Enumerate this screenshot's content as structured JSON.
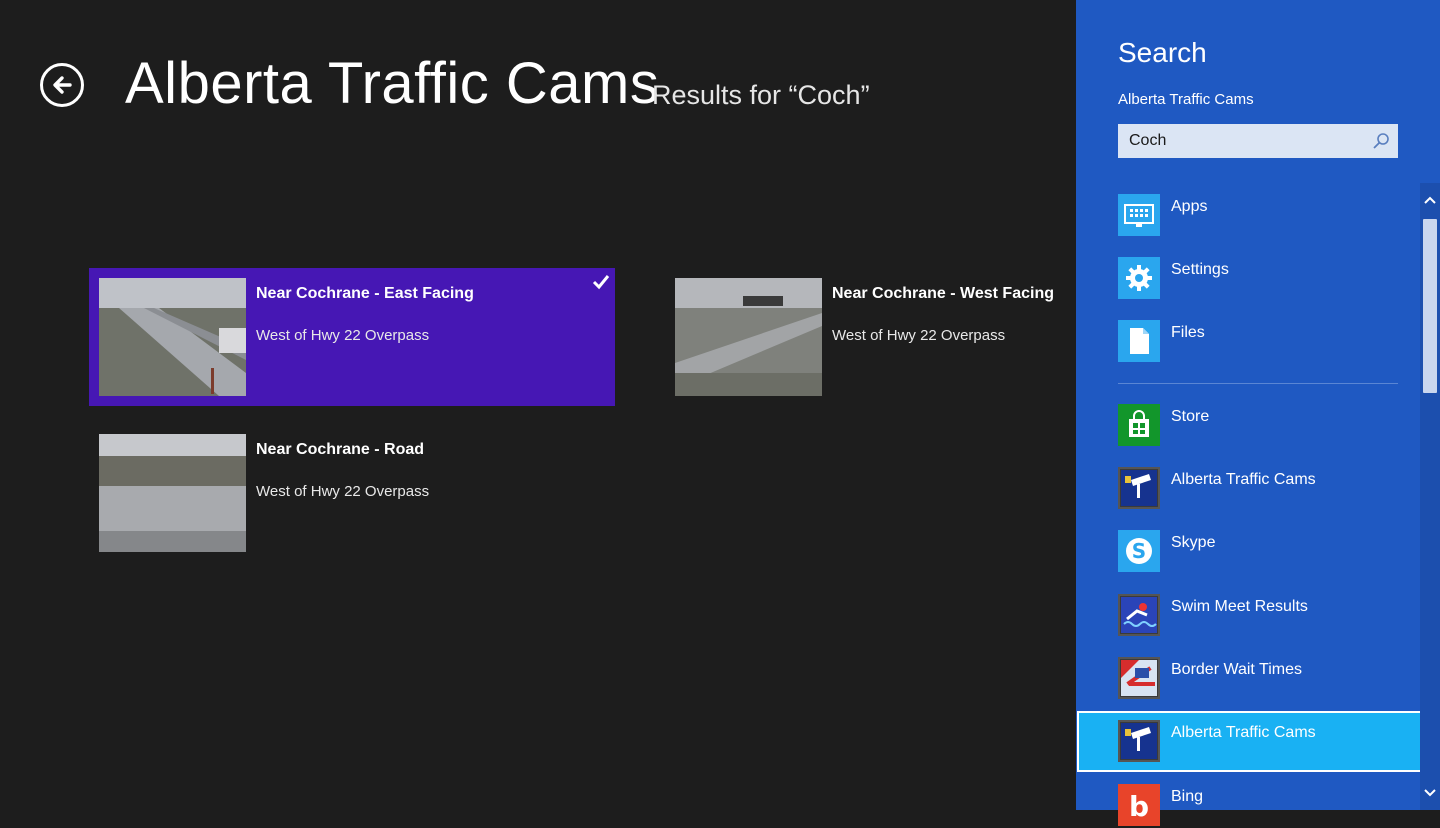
{
  "header": {
    "app_title": "Alberta Traffic Cams",
    "results_for": "Results for “Coch”"
  },
  "results": [
    {
      "title": "Near Cochrane - East Facing",
      "subtitle": "West of Hwy 22 Overpass",
      "selected": true
    },
    {
      "title": "Near Cochrane - West Facing",
      "subtitle": "West of Hwy 22 Overpass",
      "selected": false
    },
    {
      "title": "Near Cochrane - Road",
      "subtitle": "West of Hwy 22 Overpass",
      "selected": false
    }
  ],
  "search_pane": {
    "title": "Search",
    "scope": "Alberta Traffic Cams",
    "query": "Coch",
    "items": [
      {
        "label": "Apps",
        "icon": "apps-icon"
      },
      {
        "label": "Settings",
        "icon": "gear-icon"
      },
      {
        "label": "Files",
        "icon": "file-icon"
      },
      {
        "label": "Store",
        "icon": "store-icon"
      },
      {
        "label": "Alberta Traffic Cams",
        "icon": "traffic-camera-icon"
      },
      {
        "label": "Skype",
        "icon": "skype-icon"
      },
      {
        "label": "Swim Meet Results",
        "icon": "swimmer-icon"
      },
      {
        "label": "Border Wait Times",
        "icon": "flag-icon"
      },
      {
        "label": "Alberta Traffic Cams",
        "icon": "traffic-camera-icon",
        "highlighted": true
      },
      {
        "label": "Bing",
        "icon": "bing-icon"
      }
    ]
  },
  "colors": {
    "background": "#1d1d1d",
    "selected_tile": "#4617b4",
    "pane": "#1f59c2",
    "highlight": "#19b1f3",
    "tile_icon": "#2aa6ee"
  }
}
